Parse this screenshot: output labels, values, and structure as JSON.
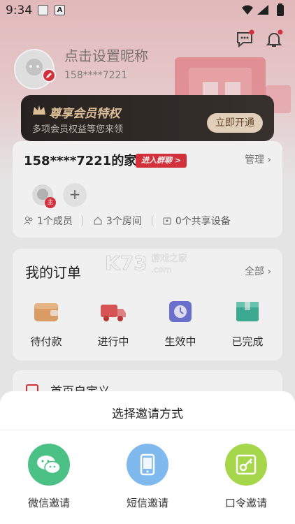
{
  "status_bar": {
    "time": "9:34"
  },
  "profile": {
    "nickname": "点击设置昵称",
    "phone": "158****7221"
  },
  "vip": {
    "title": "尊享会员特权",
    "subtitle": "多项会员权益等您来领",
    "button": "立即开通"
  },
  "home": {
    "title": "158****7221的家",
    "group_badge": "进入群聊 >",
    "manage": "管理",
    "member_tag": "主",
    "stats": {
      "members": "1个成员",
      "rooms": "3个房间",
      "devices": "0个共享设备"
    }
  },
  "orders": {
    "title": "我的订单",
    "all": "全部",
    "items": [
      {
        "label": "待付款",
        "icon": "wallet-icon"
      },
      {
        "label": "进行中",
        "icon": "truck-icon"
      },
      {
        "label": "生效中",
        "icon": "clock-icon"
      },
      {
        "label": "已完成",
        "icon": "box-icon"
      }
    ]
  },
  "partial_card": {
    "label": "首页自定义"
  },
  "sheet": {
    "title": "选择邀请方式",
    "options": [
      {
        "label": "微信邀请",
        "icon": "wechat-icon",
        "color": "#4cc186"
      },
      {
        "label": "短信邀请",
        "icon": "sms-phone-icon",
        "color": "#7fb9ee"
      },
      {
        "label": "口令邀请",
        "icon": "passcode-key-icon",
        "color": "#a6d64a"
      }
    ]
  },
  "watermark": {
    "brand": "K73",
    "text": "游戏之家",
    "domain": ".com"
  },
  "colors": {
    "accent": "#e0353f",
    "vip_bg": "#2a2522"
  }
}
